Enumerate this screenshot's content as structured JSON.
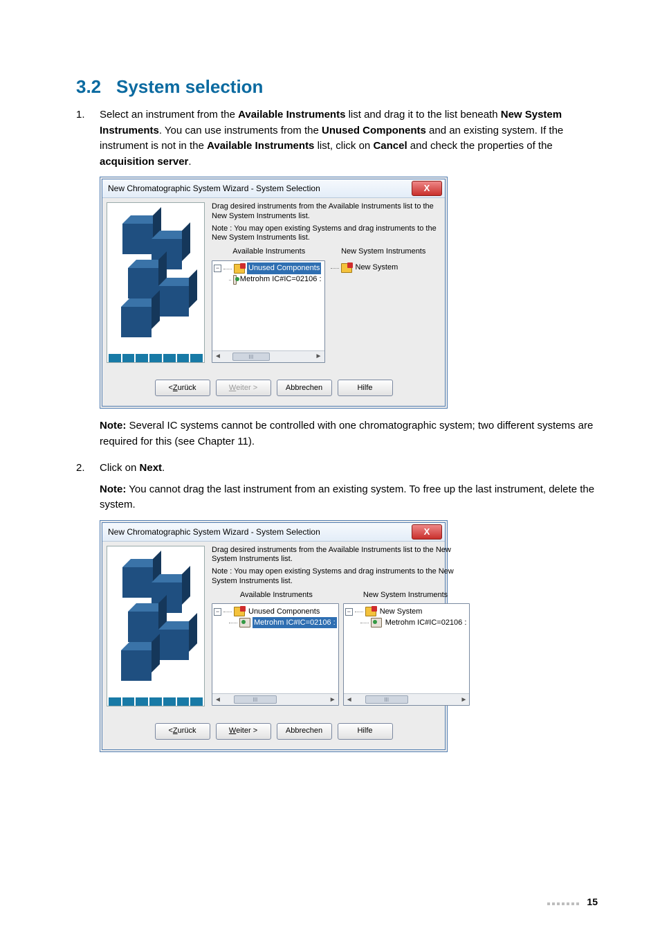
{
  "heading": {
    "number": "3.2",
    "text": "System selection"
  },
  "steps": [
    {
      "num": "1.",
      "lead_pre": "Select an instrument from the ",
      "b1": "Available Instruments",
      "mid1": " list and drag it to the list beneath ",
      "b2": "New System Instruments",
      "mid2": ". You can use instruments from the ",
      "b3": "Unused Components",
      "mid3": " and an existing system. If the instrument is not in the ",
      "b4": "Available Instruments",
      "mid4": " list, click on ",
      "b5": "Cancel",
      "mid5": " and check the properties of the ",
      "b6": "acquisition server",
      "tail": ".",
      "note_label": "Note:",
      "note_text": " Several IC systems cannot be controlled with one chromatographic system; two different systems are required for this (see Chapter 11)."
    },
    {
      "num": "2.",
      "lead_pre": "Click on ",
      "b1": "Next",
      "tail": ".",
      "note_label": "Note:",
      "note_text": " You cannot drag the last instrument from an existing system. To free up the last instrument, delete the system."
    }
  ],
  "dialog": {
    "title": "New Chromatographic System Wizard - System Selection",
    "close": "X",
    "help_text_1": "Drag desired instruments from the Available Instruments list to the New System Instruments list.",
    "help_text_2": "Note : You may open existing Systems and drag instruments to the New System Instruments list.",
    "col_left_header": "Available Instruments",
    "col_right_header": "New System Instruments",
    "unused_components": "Unused Components",
    "instrument_name": "Metrohm IC#IC=02106 :",
    "new_system": "New System",
    "toggle_minus": "−",
    "scroll_left": "◄",
    "scroll_right": "►",
    "scroll_mark": "III",
    "btn_back_u": "Z",
    "btn_back_rest": "urück",
    "btn_back_pre": "< ",
    "btn_next_u": "W",
    "btn_next_rest": "eiter >",
    "btn_cancel": "Abbrechen",
    "btn_help": "Hilfe"
  },
  "page_number": "15"
}
